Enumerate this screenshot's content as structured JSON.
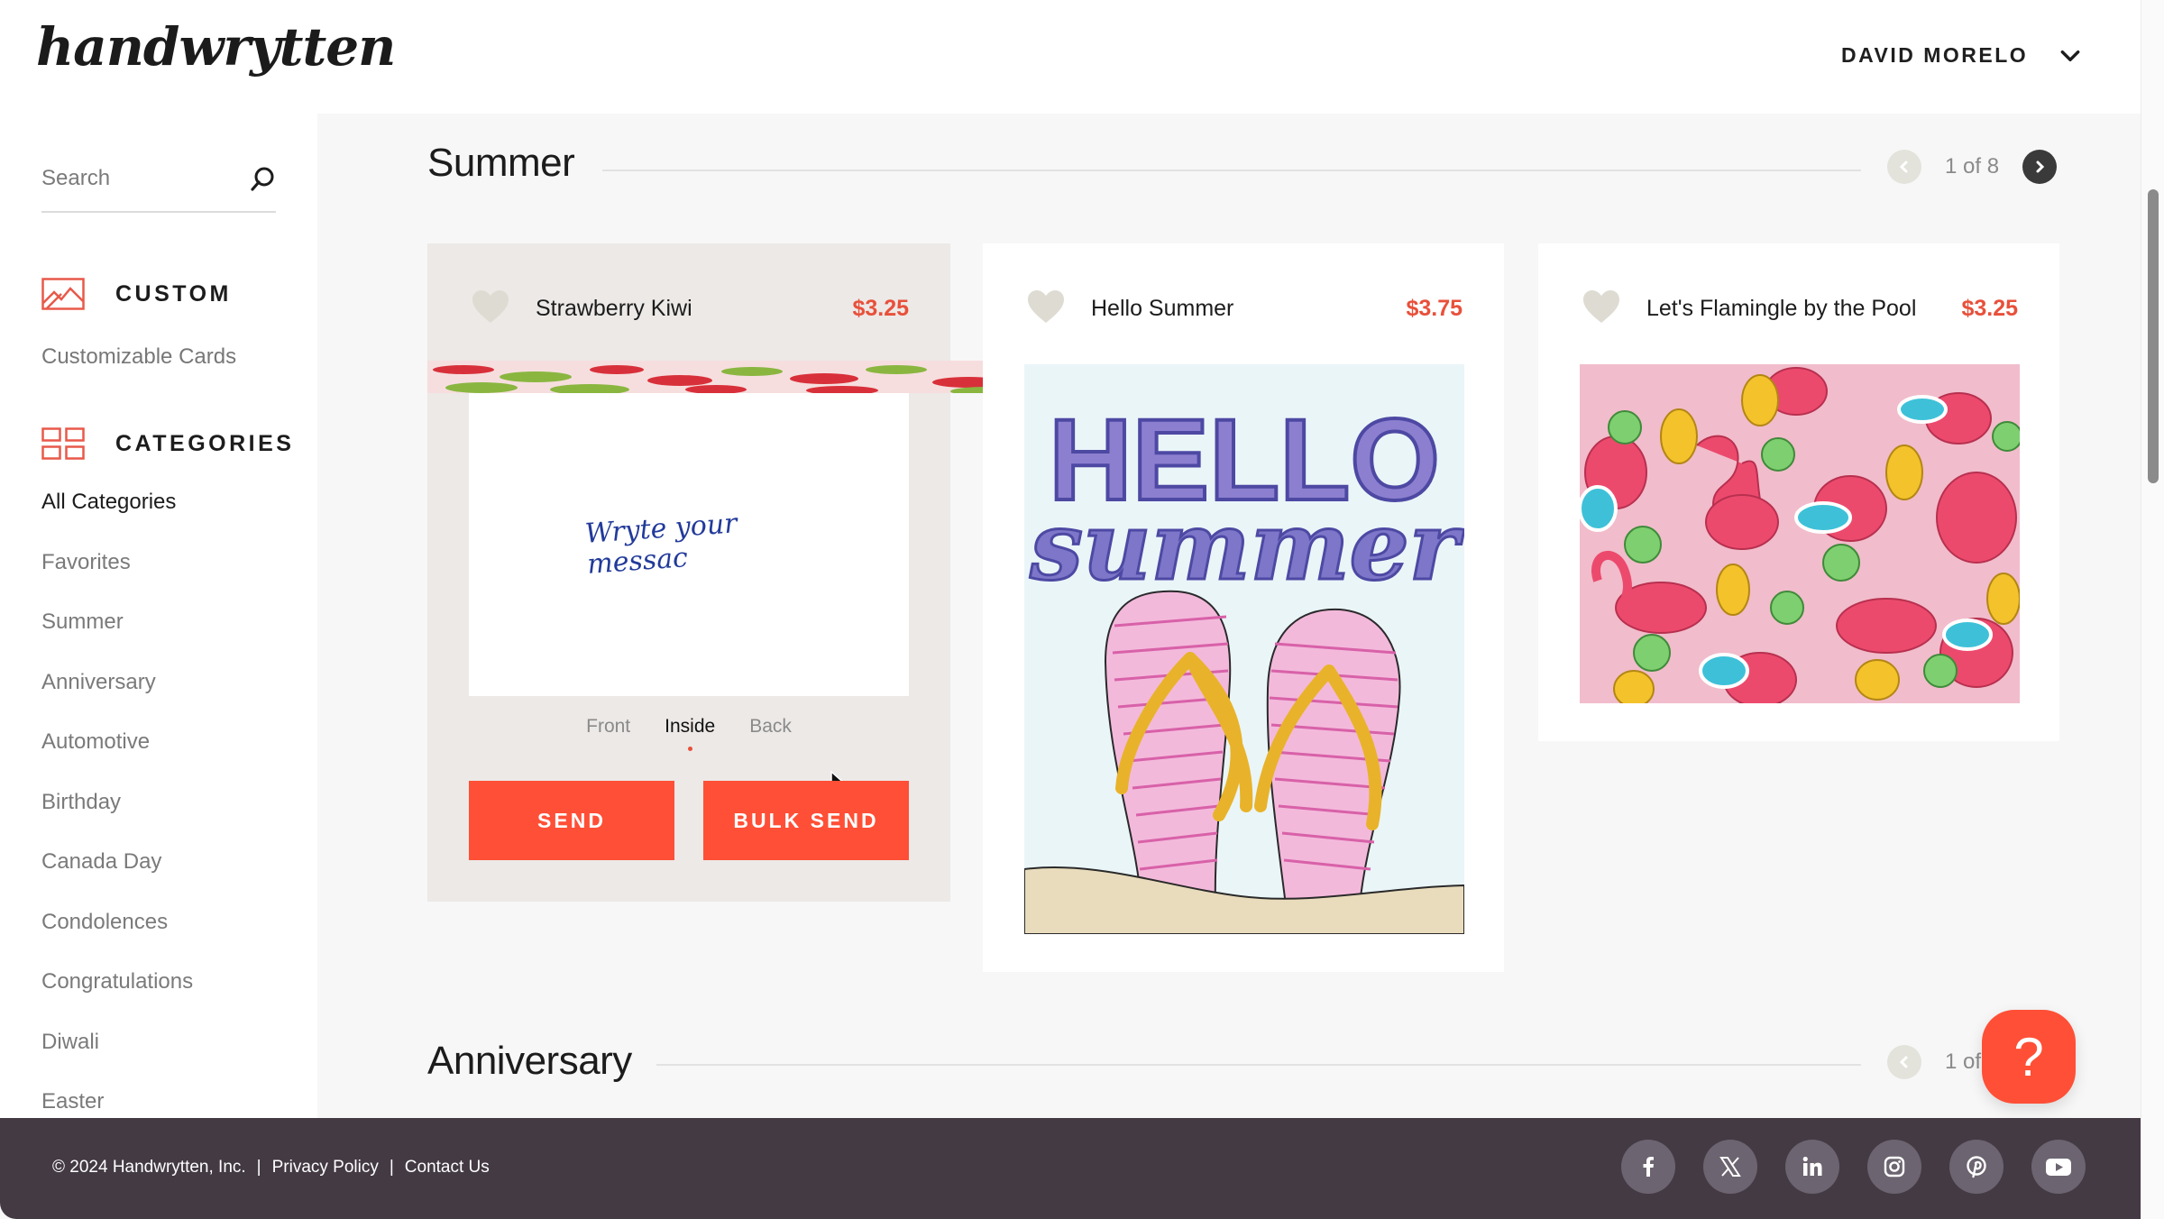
{
  "header": {
    "logo": "handwrytten",
    "user_name": "DAVID MORELO"
  },
  "sidebar": {
    "search_placeholder": "Search",
    "custom": {
      "heading": "CUSTOM",
      "link": "Customizable Cards"
    },
    "categories": {
      "heading": "CATEGORIES",
      "items": [
        {
          "label": "All Categories",
          "active": true
        },
        {
          "label": "Favorites"
        },
        {
          "label": "Summer"
        },
        {
          "label": "Anniversary"
        },
        {
          "label": "Automotive"
        },
        {
          "label": "Birthday"
        },
        {
          "label": "Canada Day"
        },
        {
          "label": "Condolences"
        },
        {
          "label": "Congratulations"
        },
        {
          "label": "Diwali"
        },
        {
          "label": "Easter"
        }
      ]
    }
  },
  "sections": [
    {
      "title": "Summer",
      "pager": "1 of 8",
      "cards": [
        {
          "name": "Strawberry Kiwi",
          "price": "$3.25",
          "inside_message_line1": "Wryte your",
          "inside_message_line2": "messac",
          "view_tabs": [
            "Front",
            "Inside",
            "Back"
          ],
          "active_view": "Inside",
          "send_label": "SEND",
          "bulk_send_label": "BULK SEND"
        },
        {
          "name": "Hello Summer",
          "price": "$3.75",
          "art_line1": "HELLO",
          "art_line2": "summer"
        },
        {
          "name": "Let's Flamingle by the Pool",
          "price": "$3.25"
        }
      ]
    },
    {
      "title": "Anniversary",
      "pager": "1 of"
    }
  ],
  "help": {
    "icon": "?"
  },
  "footer": {
    "copyright": "© 2024 Handwrytten, Inc.",
    "sep": "|",
    "privacy": "Privacy Policy",
    "contact": "Contact Us",
    "socials": [
      "facebook",
      "x",
      "linkedin",
      "instagram",
      "pinterest",
      "youtube"
    ]
  },
  "colors": {
    "accent": "#ff4f36",
    "price": "#e8503a",
    "footer_bg": "#433a44"
  }
}
